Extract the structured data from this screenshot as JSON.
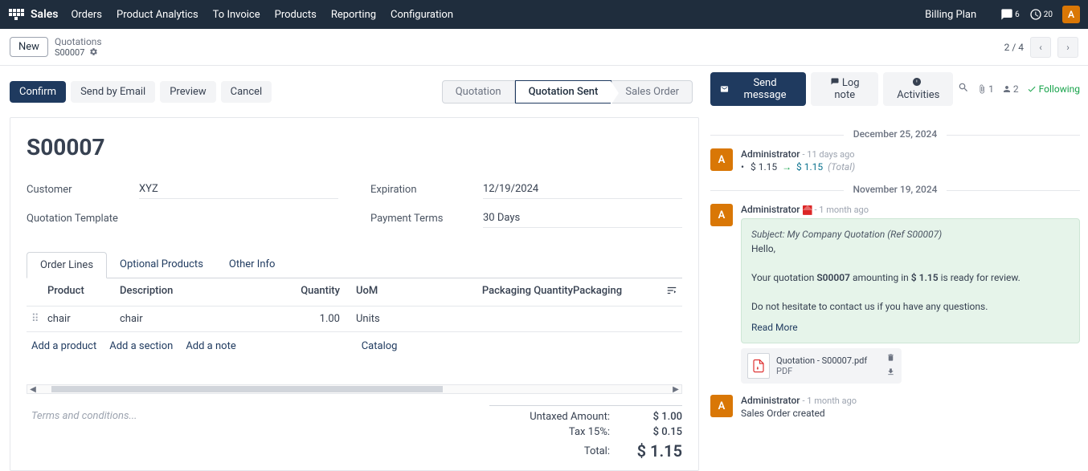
{
  "nav": {
    "brand": "Sales",
    "items": [
      "Orders",
      "Product Analytics",
      "To Invoice",
      "Products",
      "Reporting",
      "Configuration"
    ],
    "billing_plan": "Billing Plan",
    "chat_count": "6",
    "activity_count": "20",
    "avatar_initial": "A"
  },
  "breadcrumb": {
    "new_label": "New",
    "parent": "Quotations",
    "name": "S00007",
    "pager": "2 / 4"
  },
  "actions": {
    "confirm": "Confirm",
    "send_by_email": "Send by Email",
    "preview": "Preview",
    "cancel": "Cancel"
  },
  "stages": {
    "quotation": "Quotation",
    "quotation_sent": "Quotation Sent",
    "sales_order": "Sales Order"
  },
  "form": {
    "title": "S00007",
    "customer_label": "Customer",
    "customer": "XYZ",
    "template_label": "Quotation Template",
    "template": "",
    "expiration_label": "Expiration",
    "expiration": "12/19/2024",
    "payment_terms_label": "Payment Terms",
    "payment_terms": "30 Days"
  },
  "tabs": {
    "order_lines": "Order Lines",
    "optional_products": "Optional Products",
    "other_info": "Other Info"
  },
  "table": {
    "headers": {
      "product": "Product",
      "description": "Description",
      "quantity": "Quantity",
      "uom": "UoM",
      "pkg_qty": "Packaging Quantity",
      "pkg": "Packaging"
    },
    "rows": [
      {
        "product": "chair",
        "description": "chair",
        "quantity": "1.00",
        "uom": "Units",
        "pkg_qty": "",
        "pkg": ""
      }
    ],
    "add_product": "Add a product",
    "add_section": "Add a section",
    "add_note": "Add a note",
    "catalog": "Catalog"
  },
  "totals": {
    "terms_placeholder": "Terms and conditions...",
    "untaxed_label": "Untaxed Amount:",
    "untaxed": "$ 1.00",
    "tax_label": "Tax 15%:",
    "tax": "$ 0.15",
    "total_label": "Total:",
    "total": "$ 1.15"
  },
  "chatter": {
    "send_message": "Send message",
    "log_note": "Log note",
    "activities": "Activities",
    "attach_count": "1",
    "follower_count": "2",
    "following": "Following",
    "date1": "December 25, 2024",
    "date2": "November 19, 2024",
    "msg1": {
      "author": "Administrator",
      "time": "- 11 days ago",
      "old": "$ 1.15",
      "new": "$ 1.15",
      "total": "(Total)"
    },
    "msg2": {
      "author": "Administrator",
      "time": "- 1 month ago",
      "subject": "Subject: My Company Quotation (Ref S00007)",
      "hello": "Hello,",
      "body1a": "Your quotation ",
      "body1b": "S00007",
      "body1c": " amounting in ",
      "body1d": "$ 1.15",
      "body1e": " is ready for review.",
      "body2": "Do not hesitate to contact us if you have any questions.",
      "readmore": "Read More",
      "attachment_name": "Quotation - S00007.pdf",
      "attachment_type": "PDF"
    },
    "msg3": {
      "author": "Administrator",
      "time": "- 1 month ago",
      "body": "Sales Order created"
    }
  }
}
